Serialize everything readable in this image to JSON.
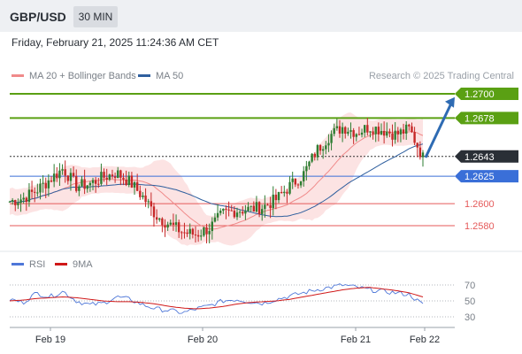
{
  "header": {
    "pair": "GBP/USD",
    "timeframe": "30 MIN"
  },
  "datetime": "Friday, February 21, 2025 11:24:36 AM CET",
  "legend": {
    "ma20_label": "MA 20 + Bollinger Bands",
    "ma50_label": "MA 50",
    "credit": "Research © 2025 Trading Central",
    "rsi_label": "RSI",
    "rsi_ma_label": "9MA"
  },
  "colors": {
    "ma20": "#f08a8a",
    "ma50": "#2f5f9e",
    "bands": "#fcdede",
    "up_candle": "#2e7d32",
    "down_candle": "#c62828",
    "resistance": "#5aa013",
    "support": "#3a6fd8",
    "target": "#e55a5a",
    "rsi": "#4e77d8",
    "rsi_ma": "#d01818",
    "arrow": "#2e6bb3"
  },
  "chart_data": {
    "type": "candlestick",
    "symbol": "GBP/USD",
    "timeframe": "30 MIN",
    "ylim": [
      1.2545,
      1.2705
    ],
    "x_ticks": [
      "Feb 19",
      "Feb 20",
      "Feb 21",
      "Feb 22"
    ],
    "levels": [
      {
        "value": 1.27,
        "label": "1.2700",
        "kind": "resistance"
      },
      {
        "value": 1.2678,
        "label": "1.2678",
        "kind": "resistance"
      },
      {
        "value": 1.2643,
        "label": "1.2643",
        "kind": "current"
      },
      {
        "value": 1.2625,
        "label": "1.2625",
        "kind": "pivot"
      },
      {
        "value": 1.26,
        "label": "1.2600",
        "kind": "support"
      },
      {
        "value": 1.258,
        "label": "1.2580",
        "kind": "support"
      }
    ],
    "forecast_arrow": {
      "from": 1.2642,
      "to": 1.2697
    },
    "price_path": [
      1.2602,
      1.2605,
      1.2612,
      1.2622,
      1.2632,
      1.2616,
      1.2618,
      1.2624,
      1.2628,
      1.262,
      1.2606,
      1.2589,
      1.2581,
      1.2574,
      1.2572,
      1.2578,
      1.2591,
      1.2594,
      1.2595,
      1.2597,
      1.2604,
      1.2616,
      1.2626,
      1.2648,
      1.2662,
      1.267,
      1.2665,
      1.267,
      1.2667,
      1.2663,
      1.2668,
      1.2642
    ],
    "rsi": {
      "ylim": [
        30,
        70
      ],
      "ticks": [
        70,
        50,
        30
      ],
      "path": [
        52,
        48,
        60,
        55,
        62,
        50,
        45,
        47,
        55,
        52,
        45,
        40,
        38,
        35,
        40,
        44,
        50,
        52,
        49,
        47,
        52,
        56,
        60,
        64,
        67,
        70,
        67,
        64,
        62,
        60,
        58,
        45
      ],
      "ma9_path": [
        50,
        51,
        53,
        54,
        55,
        54,
        52,
        50,
        49,
        49,
        48,
        46,
        43,
        41,
        40,
        41,
        43,
        46,
        48,
        49,
        50,
        52,
        55,
        58,
        61,
        64,
        66,
        67,
        65,
        63,
        60,
        55
      ]
    }
  }
}
